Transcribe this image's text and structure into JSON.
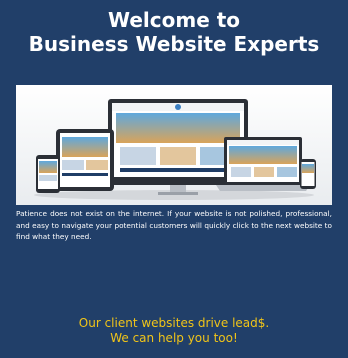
{
  "header": {
    "title_line1": "Welcome to",
    "title_line2": "Business Website Experts"
  },
  "hero": {
    "icon": "responsive-devices-illustration"
  },
  "body": {
    "paragraph": "Patience does not exist on the internet. If your website is not polished, professional, and easy to navigate your potential customers will quickly click to the next website to find what they need."
  },
  "tagline": {
    "line1": "Our client websites drive lead$.",
    "line2": "We can help you too!"
  },
  "colors": {
    "background": "#213f69",
    "accent": "#f0c419",
    "text": "#ffffff"
  }
}
